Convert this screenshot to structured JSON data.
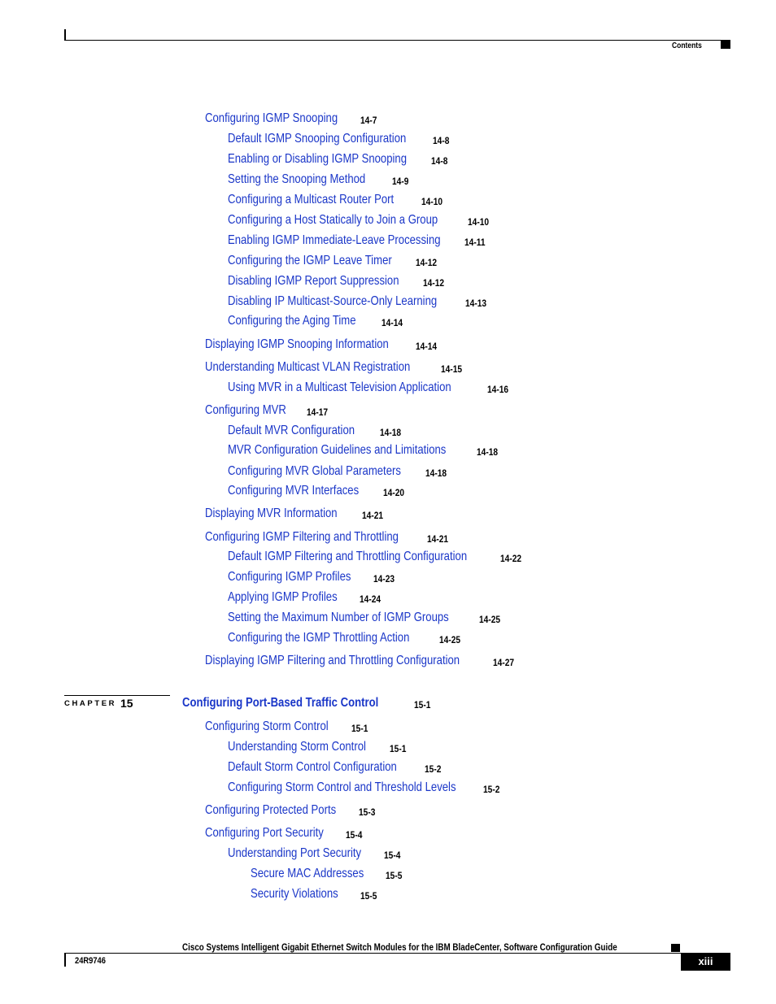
{
  "header": {
    "section_label": "Contents"
  },
  "entries_14": [
    {
      "title": "Configuring IGMP Snooping",
      "page": "14-7",
      "level": 1
    },
    {
      "title": "Default IGMP Snooping Configuration",
      "page": "14-8",
      "level": 2
    },
    {
      "title": "Enabling or Disabling IGMP Snooping",
      "page": "14-8",
      "level": 2
    },
    {
      "title": "Setting the Snooping Method",
      "page": "14-9",
      "level": 2
    },
    {
      "title": "Configuring a Multicast Router Port",
      "page": "14-10",
      "level": 2
    },
    {
      "title": "Configuring a Host Statically to Join a Group",
      "page": "14-10",
      "level": 2
    },
    {
      "title": "Enabling IGMP Immediate-Leave Processing",
      "page": "14-11",
      "level": 2
    },
    {
      "title": "Configuring the IGMP Leave Timer",
      "page": "14-12",
      "level": 2
    },
    {
      "title": "Disabling IGMP Report Suppression",
      "page": "14-12",
      "level": 2
    },
    {
      "title": "Disabling IP Multicast-Source-Only Learning",
      "page": "14-13",
      "level": 2
    },
    {
      "title": "Configuring the Aging Time",
      "page": "14-14",
      "level": 2
    },
    {
      "title": "Displaying IGMP Snooping Information",
      "page": "14-14",
      "level": 1
    },
    {
      "title": "Understanding Multicast VLAN Registration",
      "page": "14-15",
      "level": 1
    },
    {
      "title": "Using MVR in a Multicast Television Application",
      "page": "14-16",
      "level": 2
    },
    {
      "title": "Configuring MVR",
      "page": "14-17",
      "level": 1
    },
    {
      "title": "Default MVR Configuration",
      "page": "14-18",
      "level": 2
    },
    {
      "title": "MVR Configuration Guidelines and Limitations",
      "page": "14-18",
      "level": 2
    },
    {
      "title": "Configuring MVR Global Parameters",
      "page": "14-18",
      "level": 2
    },
    {
      "title": "Configuring MVR Interfaces",
      "page": "14-20",
      "level": 2
    },
    {
      "title": "Displaying MVR Information",
      "page": "14-21",
      "level": 1
    },
    {
      "title": "Configuring IGMP Filtering and Throttling",
      "page": "14-21",
      "level": 1
    },
    {
      "title": "Default IGMP Filtering and Throttling Configuration",
      "page": "14-22",
      "level": 2
    },
    {
      "title": "Configuring IGMP Profiles",
      "page": "14-23",
      "level": 2
    },
    {
      "title": "Applying IGMP Profiles",
      "page": "14-24",
      "level": 2
    },
    {
      "title": "Setting the Maximum Number of IGMP Groups",
      "page": "14-25",
      "level": 2
    },
    {
      "title": "Configuring the IGMP Throttling Action",
      "page": "14-25",
      "level": 2
    },
    {
      "title": "Displaying IGMP Filtering and Throttling Configuration",
      "page": "14-27",
      "level": 1
    }
  ],
  "chapter": {
    "label": "CHAPTER",
    "number": "15",
    "title": "Configuring Port-Based Traffic Control",
    "page": "15-1"
  },
  "entries_15": [
    {
      "title": "Configuring Storm Control",
      "page": "15-1",
      "level": 1
    },
    {
      "title": "Understanding Storm Control",
      "page": "15-1",
      "level": 2
    },
    {
      "title": "Default Storm Control Configuration",
      "page": "15-2",
      "level": 2
    },
    {
      "title": "Configuring Storm Control and Threshold Levels",
      "page": "15-2",
      "level": 2
    },
    {
      "title": "Configuring Protected Ports",
      "page": "15-3",
      "level": 1
    },
    {
      "title": "Configuring Port Security",
      "page": "15-4",
      "level": 1
    },
    {
      "title": "Understanding Port Security",
      "page": "15-4",
      "level": 2
    },
    {
      "title": "Secure MAC Addresses",
      "page": "15-5",
      "level": 3
    },
    {
      "title": "Security Violations",
      "page": "15-5",
      "level": 3
    }
  ],
  "footer": {
    "book_title": "Cisco Systems Intelligent Gigabit Ethernet Switch Modules for the IBM BladeCenter, Software Configuration Guide",
    "doc_number": "24R9746",
    "page_number": "xiii"
  }
}
